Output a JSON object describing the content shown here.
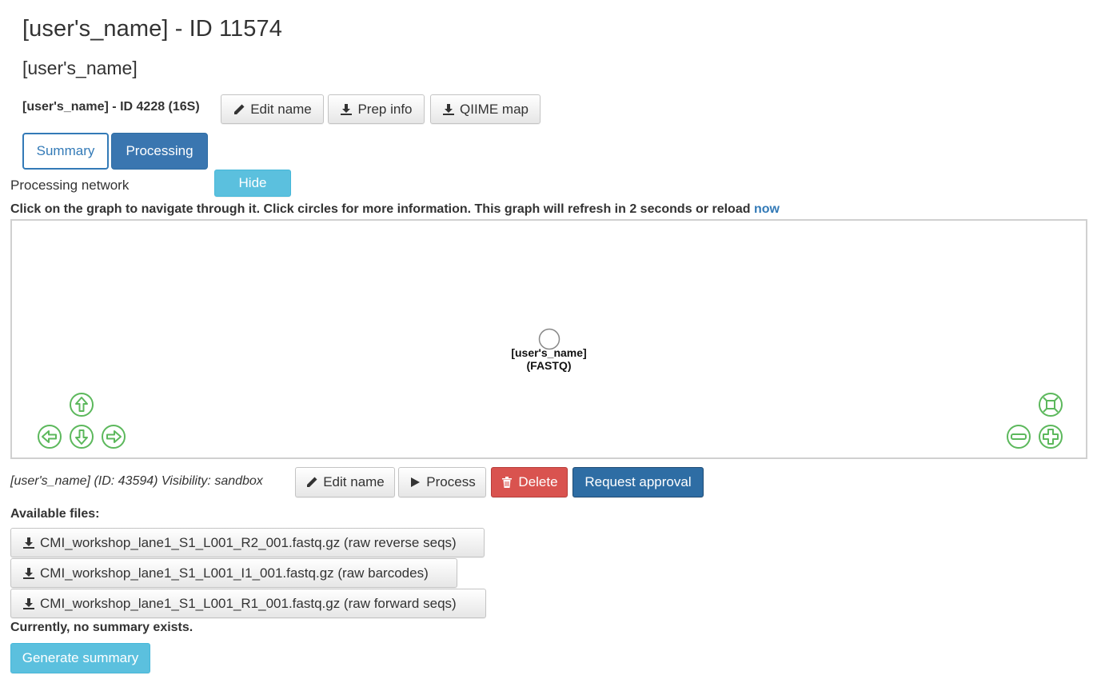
{
  "header": {
    "title": "[user's_name] - ID 11574",
    "subtitle": "[user's_name]"
  },
  "prep": {
    "label": "[user's_name] - ID 4228 (16S)",
    "edit_name": "Edit name",
    "prep_info": "Prep info",
    "qiime_map": "QIIME map"
  },
  "tabs": {
    "summary": "Summary",
    "processing": "Processing"
  },
  "network": {
    "label": "Processing network",
    "hide_button": "Hide",
    "hint": "Click on the graph to navigate through it. Click circles for more information. This graph will refresh in 2 seconds or reload ",
    "reload_link": "now",
    "node_name": "[user's_name]",
    "node_type": "(FASTQ)"
  },
  "dataset": {
    "info": "[user's_name] (ID: 43594) Visibility: sandbox",
    "edit_name": "Edit name",
    "process": "Process",
    "delete": "Delete",
    "request_approval": "Request approval"
  },
  "files": {
    "heading": "Available files:",
    "items": [
      "CMI_workshop_lane1_S1_L001_R2_001.fastq.gz (raw reverse seqs)",
      "CMI_workshop_lane1_S1_L001_I1_001.fastq.gz (raw barcodes)",
      "CMI_workshop_lane1_S1_L001_R1_001.fastq.gz (raw forward seqs)"
    ]
  },
  "summary": {
    "none_text": "Currently, no summary exists.",
    "generate_button": "Generate summary"
  },
  "colors": {
    "primary": "#337ab7",
    "info": "#5bc0de",
    "danger": "#d9534f",
    "nav_green": "#5cb85c"
  }
}
